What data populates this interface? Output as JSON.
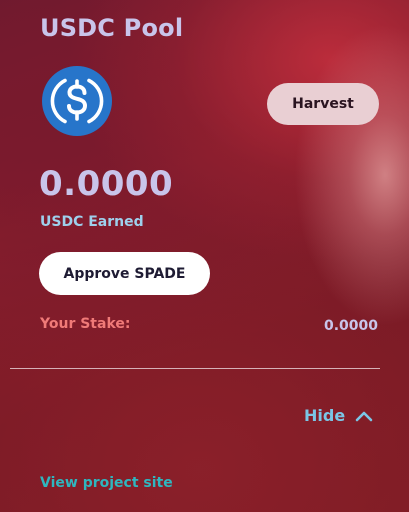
{
  "pool": {
    "title": "USDC Pool",
    "token_icon": "usdc-coin-icon",
    "harvest_label": "Harvest",
    "earned_value": "0.0000",
    "earned_label": "USDC Earned",
    "approve_label": "Approve SPADE",
    "stake_label": "Your Stake:",
    "stake_value": "0.0000",
    "hide_label": "Hide",
    "project_link": "View project site"
  },
  "colors": {
    "title": "#c9c4ea",
    "earned_label": "#9ed0ec",
    "stake_label": "#f07a78",
    "hide": "#7bc6e6",
    "link": "#2fb6bf",
    "usdc_blue": "#2775ca",
    "harvest_bg": "#e9cfd3",
    "approve_bg": "#ffffff"
  }
}
